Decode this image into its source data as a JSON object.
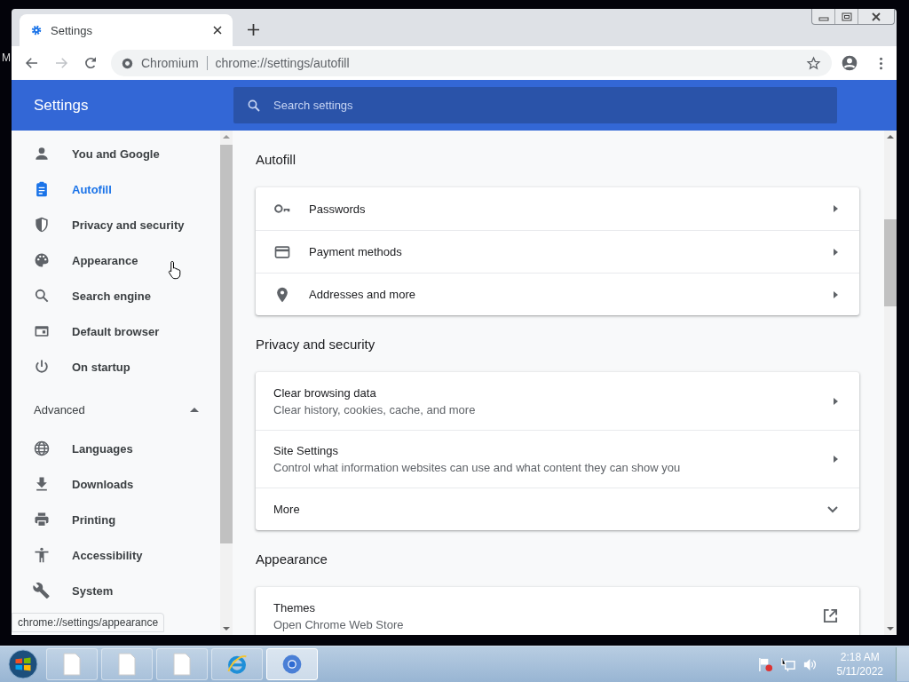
{
  "desktop": {
    "label": "M"
  },
  "browser": {
    "tab": {
      "title": "Settings",
      "selected": true
    },
    "omnibox": {
      "site": "Chromium",
      "url": "chrome://settings/autofill"
    },
    "status_bubble": "chrome://settings/appearance"
  },
  "header": {
    "title": "Settings",
    "search": {
      "placeholder": "Search settings"
    }
  },
  "sidebar": {
    "items": [
      {
        "label": "You and Google",
        "selected": false
      },
      {
        "label": "Autofill",
        "selected": true
      },
      {
        "label": "Privacy and security",
        "selected": false
      },
      {
        "label": "Appearance",
        "selected": false
      },
      {
        "label": "Search engine",
        "selected": false
      },
      {
        "label": "Default browser",
        "selected": false
      },
      {
        "label": "On startup",
        "selected": false
      }
    ],
    "advanced": {
      "label": "Advanced",
      "expanded": true,
      "items": [
        {
          "label": "Languages",
          "selected": false
        },
        {
          "label": "Downloads",
          "selected": false
        },
        {
          "label": "Printing",
          "selected": false
        },
        {
          "label": "Accessibility",
          "selected": false
        },
        {
          "label": "System",
          "selected": false
        }
      ]
    }
  },
  "sections": [
    {
      "title": "Autofill",
      "rows": [
        {
          "kind": "link",
          "label": "Passwords"
        },
        {
          "kind": "link",
          "label": "Payment methods"
        },
        {
          "kind": "link",
          "label": "Addresses and more"
        }
      ]
    },
    {
      "title": "Privacy and security",
      "rows": [
        {
          "kind": "link",
          "label": "Clear browsing data",
          "description": "Clear history, cookies, cache, and more"
        },
        {
          "kind": "link",
          "label": "Site Settings",
          "description": "Control what information websites can use and what content they can show you"
        },
        {
          "kind": "expand",
          "label": "More"
        }
      ]
    },
    {
      "title": "Appearance",
      "rows": [
        {
          "kind": "external",
          "label": "Themes",
          "description": "Open Chrome Web Store"
        }
      ]
    }
  ],
  "taskbar": {
    "buttons": [
      {
        "selected": false
      },
      {
        "selected": false
      },
      {
        "selected": false
      },
      {
        "selected": false
      },
      {
        "selected": true
      }
    ],
    "clock": {
      "time": "2:18 AM",
      "date": "5/11/2022"
    }
  }
}
